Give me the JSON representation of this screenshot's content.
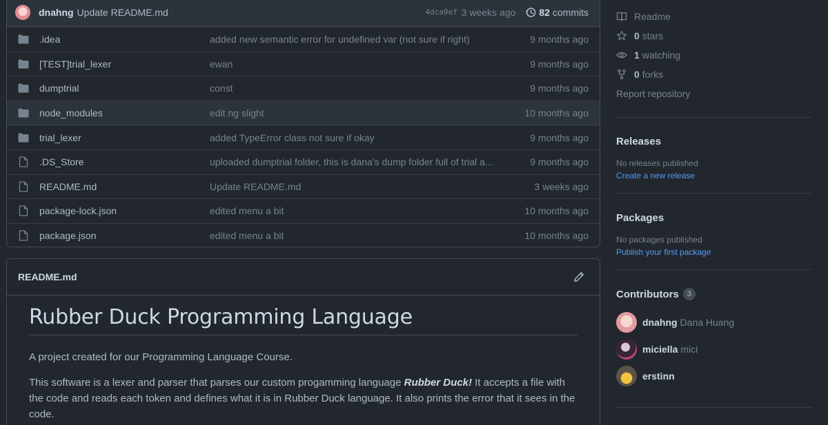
{
  "latest_commit": {
    "author": "dnahng",
    "message": "Update README.md",
    "sha": "4dca9ef",
    "time": "3 weeks ago",
    "commit_count": "82",
    "commits_label": "commits"
  },
  "files": [
    {
      "type": "folder",
      "name": ".idea",
      "message": "added new semantic error for undefined var (not sure if right)",
      "age": "9 months ago"
    },
    {
      "type": "folder",
      "name": "[TEST]trial_lexer",
      "message": "ewan",
      "age": "9 months ago"
    },
    {
      "type": "folder",
      "name": "dumptrial",
      "message": "const",
      "age": "9 months ago"
    },
    {
      "type": "folder",
      "name": "node_modules",
      "message": "edit ng slight",
      "age": "10 months ago"
    },
    {
      "type": "folder",
      "name": "trial_lexer",
      "message": "added TypeError class not sure if okay",
      "age": "9 months ago"
    },
    {
      "type": "file",
      "name": ".DS_Store",
      "message": "uploaded dumptrial folder, this is dana's dump folder full of trial a...",
      "age": "9 months ago"
    },
    {
      "type": "file",
      "name": "README.md",
      "message": "Update README.md",
      "age": "3 weeks ago"
    },
    {
      "type": "file",
      "name": "package-lock.json",
      "message": "edited menu a bit",
      "age": "10 months ago"
    },
    {
      "type": "file",
      "name": "package.json",
      "message": "edited menu a bit",
      "age": "10 months ago"
    }
  ],
  "readme": {
    "filename": "README.md",
    "heading": "Rubber Duck Programming Language",
    "para1": "A project created for our Programming Language Course.",
    "para2_before": "This software is a lexer and parser that parses our custom progamming language ",
    "para2_em": "Rubber Duck!",
    "para2_after": " It accepts a file with the code and reads each token and defines what it is in Rubber Duck language. It also prints the error that it sees in the code."
  },
  "sidebar": {
    "readme_label": "Readme",
    "stars_count": "0",
    "stars_label": "stars",
    "watching_count": "1",
    "watching_label": "watching",
    "forks_count": "0",
    "forks_label": "forks",
    "report_label": "Report repository",
    "releases": {
      "title": "Releases",
      "empty": "No releases published",
      "link": "Create a new release"
    },
    "packages": {
      "title": "Packages",
      "empty": "No packages published",
      "link": "Publish your first package"
    },
    "contributors": {
      "title": "Contributors",
      "count": "3",
      "list": [
        {
          "login": "dnahng",
          "name": "Dana Huang"
        },
        {
          "login": "miciella",
          "name": "mici"
        },
        {
          "login": "erstinn",
          "name": ""
        }
      ]
    }
  },
  "colors": {
    "background": "#22272e",
    "folder": "#768390",
    "link": "#539bf5"
  }
}
